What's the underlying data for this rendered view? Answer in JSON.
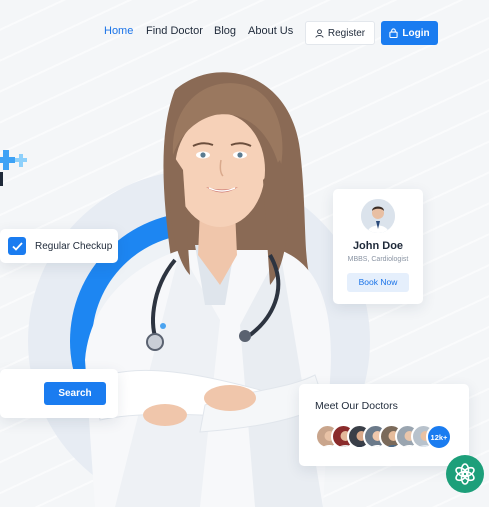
{
  "nav": {
    "links": [
      {
        "label": "Home",
        "active": true
      },
      {
        "label": "Find Doctor",
        "active": false
      },
      {
        "label": "Blog",
        "active": false
      },
      {
        "label": "About Us",
        "active": false
      }
    ],
    "register_label": "Register",
    "login_label": "Login"
  },
  "hero": {
    "checkup_label": "Regular Checkup",
    "search_label": "Search"
  },
  "doctor_card": {
    "name": "John Doe",
    "specialty": "MBBS, Cardiologist",
    "book_label": "Book Now"
  },
  "meet_card": {
    "title": "Meet Our Doctors",
    "count_label": "12k+"
  },
  "icons": {
    "register": "user-icon",
    "login": "lock-icon",
    "checkup": "check-icon",
    "fab": "chat-assistant-icon",
    "decor": "plus-cross-icon"
  },
  "colors": {
    "primary": "#1a7cf0",
    "ring": "#1d86f2",
    "background": "#f4f6f8",
    "fab": "#1d9f7a",
    "text": "#1f2a3a"
  }
}
